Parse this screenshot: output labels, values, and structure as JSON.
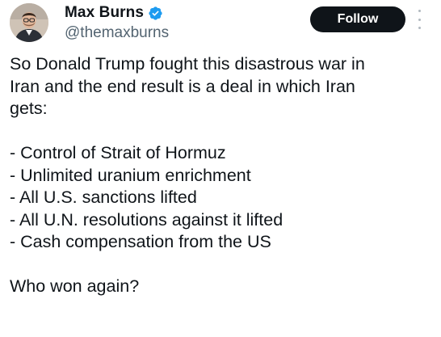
{
  "author": {
    "display_name": "Max Burns",
    "handle": "@themaxburns",
    "verified": true,
    "verified_color": "#1d9bf0"
  },
  "follow_button": {
    "label": "Follow"
  },
  "more_menu": {
    "icon": "more-vertical-icon"
  },
  "tweet": {
    "intro_lines": [
      "So Donald Trump fought this disastrous war in",
      "Iran and the end result is a deal in which Iran",
      "gets:"
    ],
    "list_items": [
      "- Control of Strait of Hormuz",
      "- Unlimited uranium enrichment",
      "- All U.S. sanctions lifted",
      "- All U.N. resolutions against it lifted",
      "- Cash compensation from the US"
    ],
    "closing": "Who won again?"
  },
  "colors": {
    "text": "#0f1419",
    "secondary_text": "#536471",
    "button_bg": "#0f1419",
    "button_text": "#ffffff"
  }
}
